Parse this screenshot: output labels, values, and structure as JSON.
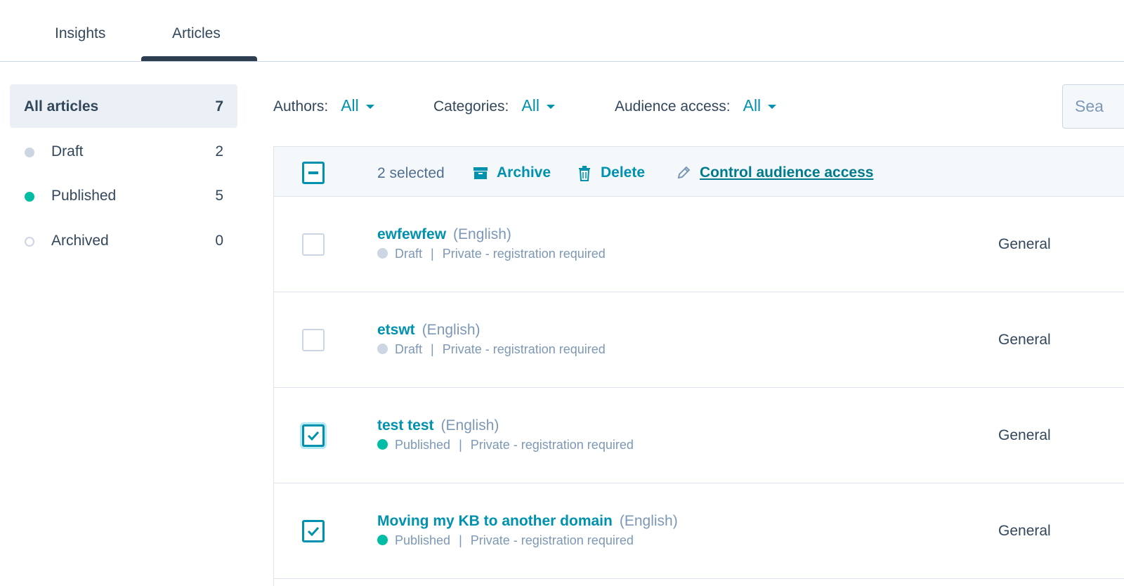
{
  "tabs": [
    {
      "label": "Insights"
    },
    {
      "label": "Articles"
    }
  ],
  "sidebar": {
    "items": [
      {
        "label": "All articles",
        "count": "7"
      },
      {
        "label": "Draft",
        "count": "2"
      },
      {
        "label": "Published",
        "count": "5"
      },
      {
        "label": "Archived",
        "count": "0"
      }
    ]
  },
  "filters": {
    "authors": {
      "label": "Authors:",
      "value": "All"
    },
    "categories": {
      "label": "Categories:",
      "value": "All"
    },
    "audience": {
      "label": "Audience access:",
      "value": "All"
    }
  },
  "search": {
    "placeholder": "Sea"
  },
  "bulk": {
    "selected_text": "2 selected",
    "archive_label": "Archive",
    "delete_label": "Delete",
    "audience_label": "Control audience access"
  },
  "rows": [
    {
      "name": "ewfewfew",
      "language": "(English)",
      "status": "Draft",
      "separator": "|",
      "access": "Private - registration required",
      "category": "General",
      "checked": false
    },
    {
      "name": "etswt",
      "language": "(English)",
      "status": "Draft",
      "separator": "|",
      "access": "Private - registration required",
      "category": "General",
      "checked": false
    },
    {
      "name": "test test",
      "language": "(English)",
      "status": "Published",
      "separator": "|",
      "access": "Private - registration required",
      "category": "General",
      "checked": true
    },
    {
      "name": "Moving my KB to another domain",
      "language": "(English)",
      "status": "Published",
      "separator": "|",
      "access": "Private - registration required",
      "category": "General",
      "checked": true
    }
  ],
  "colors": {
    "accent": "#0091ae",
    "draft": "#cbd6e2",
    "published": "#00bda5",
    "text": "#33475b"
  }
}
